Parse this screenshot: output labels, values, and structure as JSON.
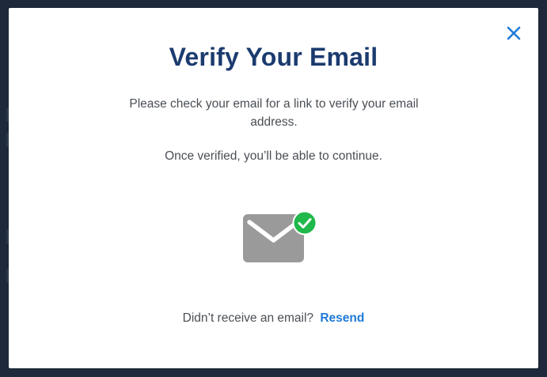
{
  "modal": {
    "title": "Verify Your Email",
    "message_line": "Please check your email for a link to verify your email address.",
    "message_continue": "Once verified, you’ll be able to continue.",
    "footer_prompt": "Didn’t receive an email?",
    "resend_label": "Resend"
  },
  "icons": {
    "close": "close-icon",
    "mail": "mail-icon",
    "check": "check-circle-icon"
  },
  "colors": {
    "title": "#1b3b6f",
    "link": "#1f7ad8",
    "close": "#1f7ad8",
    "envelope": "#9a9a9a",
    "check_badge": "#1fb84a",
    "overlay": "#1f2b3c"
  }
}
